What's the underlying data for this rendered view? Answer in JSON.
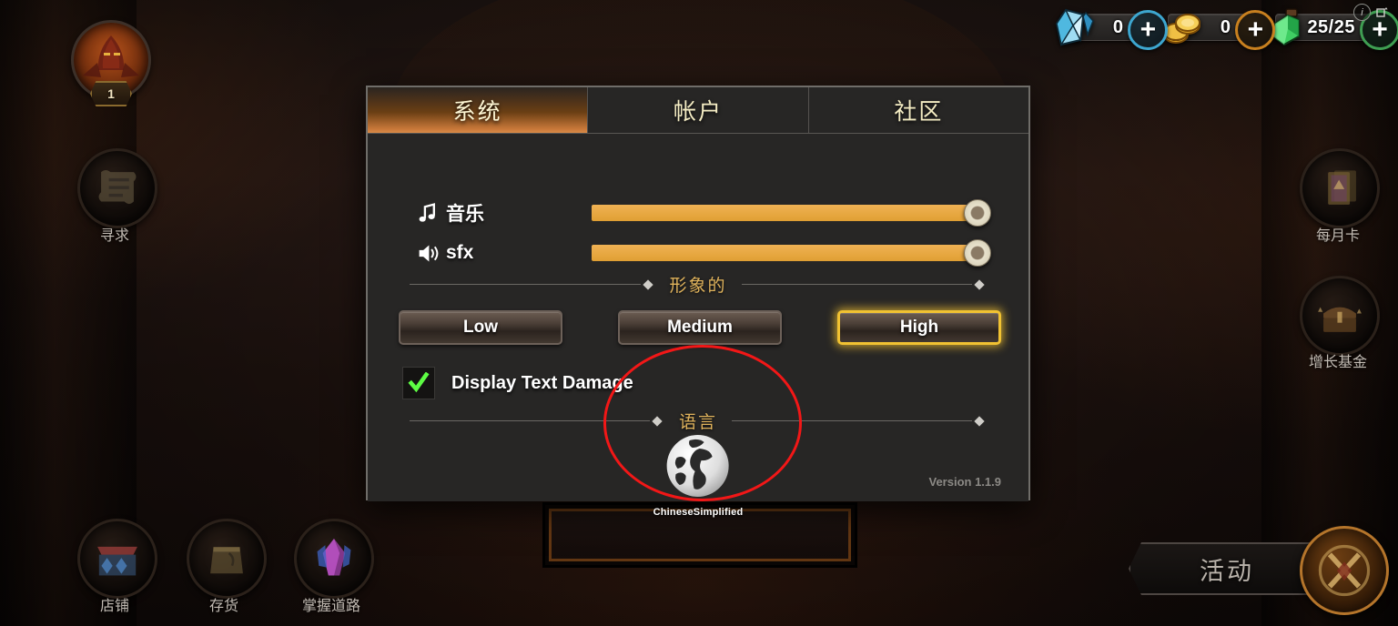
{
  "hud": {
    "avatar": {
      "name": "avatar-portrait",
      "level": "1"
    },
    "left_buttons": [
      {
        "icon": "scroll-icon",
        "label": "寻求"
      }
    ],
    "right_buttons": [
      {
        "icon": "monthly-card-icon",
        "label": "每月卡"
      },
      {
        "icon": "treasure-chest-icon",
        "label": "增长基金"
      }
    ],
    "bottom_buttons": [
      {
        "icon": "shop-icon",
        "label": "店铺"
      },
      {
        "icon": "inventory-bag-icon",
        "label": "存货"
      },
      {
        "icon": "crystal-icon",
        "label": "掌握道路"
      }
    ],
    "events": {
      "label": "活动",
      "emblem": "crossed-swords-icon"
    }
  },
  "currencies": [
    {
      "id": "gem",
      "icon": "gem-icon",
      "value": "0",
      "plus": "+",
      "accent": "#3da6cf"
    },
    {
      "id": "gold",
      "icon": "gold-coins-icon",
      "value": "0",
      "plus": "+",
      "accent": "#c8801f"
    },
    {
      "id": "energy",
      "icon": "energy-potion-icon",
      "value": "25/25",
      "plus": "+",
      "accent": "#3f9e52",
      "info": "i"
    }
  ],
  "dialog": {
    "tabs": [
      {
        "id": "system",
        "label": "系统",
        "active": true
      },
      {
        "id": "account",
        "label": "帐户",
        "active": false
      },
      {
        "id": "community",
        "label": "社区",
        "active": false
      }
    ],
    "audio": {
      "music": {
        "icon": "music-note-icon",
        "label": "音乐",
        "value": 100
      },
      "sfx": {
        "icon": "speaker-icon",
        "label": "sfx",
        "value": 100
      }
    },
    "graphics": {
      "section_title": "形象的",
      "options": [
        {
          "id": "low",
          "label": "Low",
          "selected": false
        },
        {
          "id": "medium",
          "label": "Medium",
          "selected": false
        },
        {
          "id": "high",
          "label": "High",
          "selected": true
        }
      ]
    },
    "text_damage": {
      "label": "Display Text Damage",
      "checked": true,
      "check_icon": "checkmark-icon"
    },
    "language": {
      "section_title": "语言",
      "icon": "globe-icon",
      "current": "ChineseSimplified"
    },
    "version": "Version 1.1.9"
  },
  "annotation": {
    "shape": "red-ellipse",
    "color": "#f21717"
  }
}
